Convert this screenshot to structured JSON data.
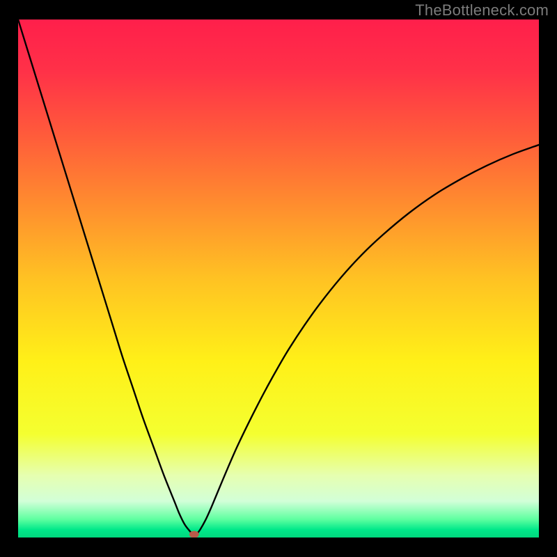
{
  "watermark": "TheBottleneck.com",
  "chart_data": {
    "type": "line",
    "title": "",
    "xlabel": "",
    "ylabel": "",
    "xlim": [
      0,
      100
    ],
    "ylim": [
      0,
      100
    ],
    "series": [
      {
        "name": "curve",
        "x": [
          0,
          2,
          4,
          6,
          8,
          10,
          12,
          14,
          16,
          18,
          20,
          22,
          24,
          26,
          28,
          30,
          31,
          32,
          33,
          33.6,
          34,
          34.4,
          35,
          36,
          37,
          38,
          40,
          42,
          44,
          46,
          48,
          50,
          52,
          55,
          58,
          62,
          66,
          70,
          75,
          80,
          85,
          90,
          95,
          100
        ],
        "y": [
          100,
          93.5,
          87,
          80.5,
          74,
          67.5,
          61,
          54.5,
          48,
          41.5,
          35,
          29,
          23,
          17.5,
          12,
          7,
          4.5,
          2.5,
          1.2,
          0.6,
          0.6,
          0.8,
          1.6,
          3.4,
          5.6,
          8,
          12.8,
          17.4,
          21.6,
          25.6,
          29.4,
          33,
          36.4,
          41,
          45.2,
          50.2,
          54.6,
          58.4,
          62.6,
          66.2,
          69.2,
          71.8,
          74,
          75.8
        ]
      }
    ],
    "marker": {
      "x": 33.8,
      "y": 0.6
    },
    "gradient_stops": [
      {
        "offset": 0.0,
        "color": "#ff1f4b"
      },
      {
        "offset": 0.1,
        "color": "#ff3148"
      },
      {
        "offset": 0.22,
        "color": "#ff5a3b"
      },
      {
        "offset": 0.35,
        "color": "#ff8a2f"
      },
      {
        "offset": 0.5,
        "color": "#ffc223"
      },
      {
        "offset": 0.66,
        "color": "#fff018"
      },
      {
        "offset": 0.8,
        "color": "#f4ff30"
      },
      {
        "offset": 0.88,
        "color": "#e6ffb0"
      },
      {
        "offset": 0.93,
        "color": "#d2ffd8"
      },
      {
        "offset": 0.965,
        "color": "#5effa0"
      },
      {
        "offset": 0.985,
        "color": "#00e88a"
      },
      {
        "offset": 1.0,
        "color": "#00d87e"
      }
    ]
  }
}
